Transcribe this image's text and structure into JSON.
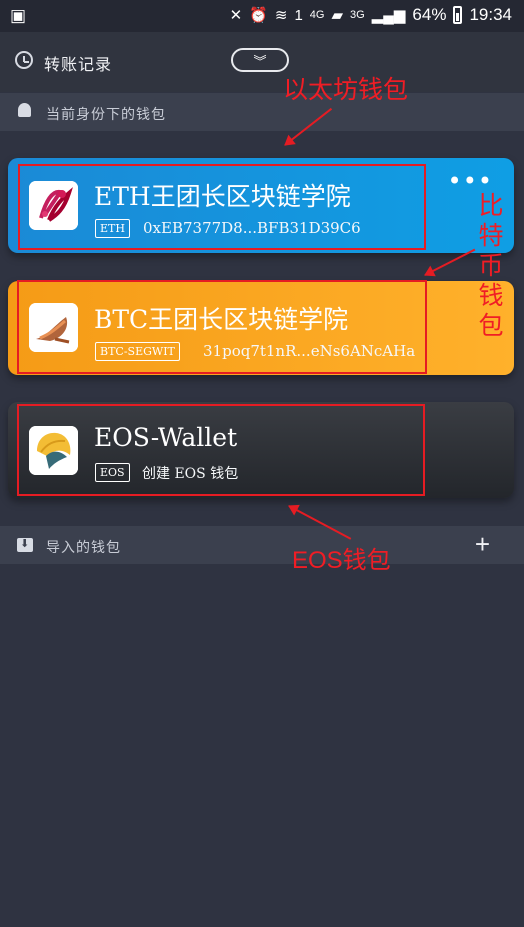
{
  "status_bar": {
    "network_4g": "4G",
    "network_3g": "3G",
    "battery_percent": "64%",
    "time": "19:34"
  },
  "transfer_history": {
    "label": "转账记录"
  },
  "current_wallets": {
    "label": "当前身份下的钱包",
    "items": [
      {
        "name": "ETH王团长区块链学院",
        "chain": "ETH",
        "address": "0xEB7377D8...BFB31D39C6",
        "color": "#1a92df"
      },
      {
        "name": "BTC王团长区块链学院",
        "chain": "BTC-SEGWIT",
        "address": "31poq7t1nR...eNs6ANcAHa",
        "color": "#f7a51f"
      },
      {
        "name": "EOS-Wallet",
        "chain": "EOS",
        "address": "创建 EOS 钱包",
        "color": "#2f3238"
      }
    ]
  },
  "imported_wallets": {
    "label": "导入的钱包"
  },
  "annotations": {
    "eth": "以太坊钱包",
    "btc": "比特币钱包",
    "eos": "EOS钱包"
  },
  "icons": {
    "more": "•••",
    "plus": "+",
    "chevron": "︾"
  }
}
